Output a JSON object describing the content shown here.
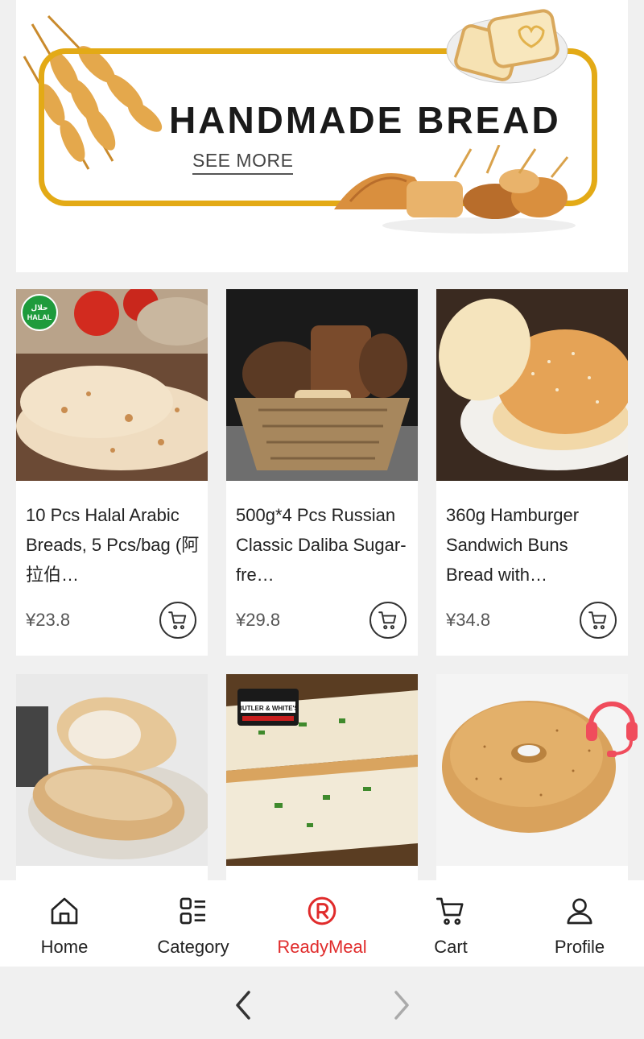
{
  "banner": {
    "title": "HANDMADE BREAD",
    "see_more": "SEE MORE"
  },
  "products": [
    {
      "name": "10 Pcs Halal Arabic Breads, 5 Pcs/bag (阿拉伯…",
      "price": "¥23.8",
      "badge": "HALAL"
    },
    {
      "name": "500g*4 Pcs Russian Classic Daliba Sugar-fre…",
      "price": "¥29.8"
    },
    {
      "name": "360g Hamburger Sandwich Buns Bread with…",
      "price": "¥34.8"
    },
    {
      "name": "",
      "price": ""
    },
    {
      "name": "",
      "price": "",
      "logo_text": "BUTLER & WHITE'S"
    },
    {
      "name": "",
      "price": ""
    }
  ],
  "nav": {
    "items": [
      {
        "label": "Home",
        "icon": "home-icon"
      },
      {
        "label": "Category",
        "icon": "category-icon"
      },
      {
        "label": "ReadyMeal",
        "icon": "readymeal-icon"
      },
      {
        "label": "Cart",
        "icon": "cart-icon"
      },
      {
        "label": "Profile",
        "icon": "profile-icon"
      }
    ],
    "active_index": 2,
    "active_color": "#e02b2b"
  },
  "colors": {
    "banner_accent": "#e3aa16",
    "support_icon": "#f04c5c"
  }
}
